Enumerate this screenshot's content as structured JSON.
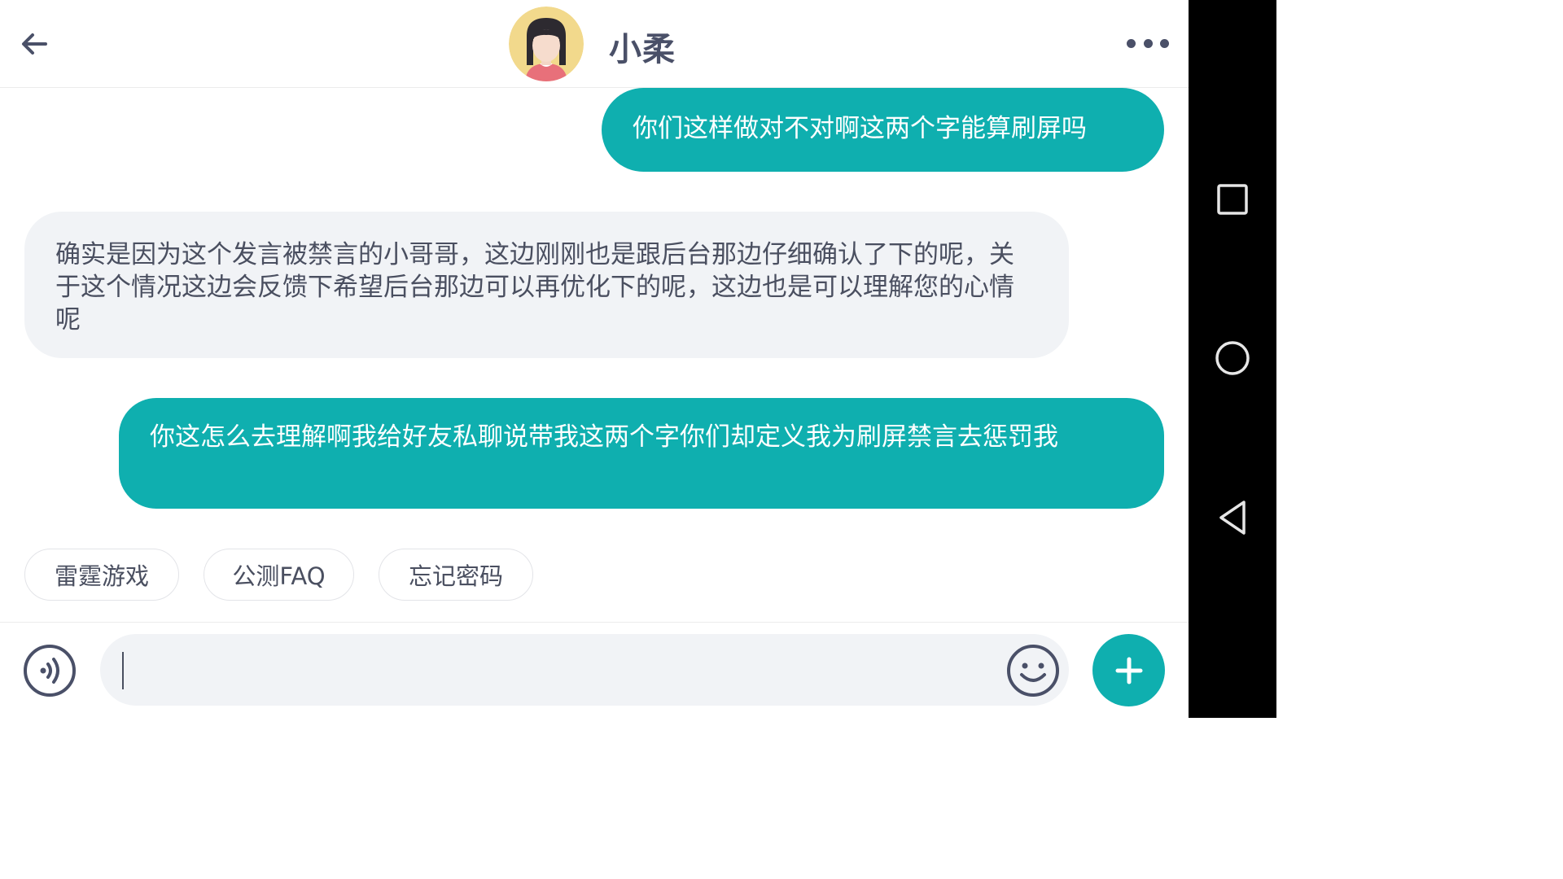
{
  "header": {
    "title": "小柔",
    "back_icon": "back-arrow-icon",
    "more_icon": "more-dots-icon",
    "avatar_icon": "girl-avatar"
  },
  "messages": [
    {
      "side": "out",
      "text": "你们这样做对不对啊这两个字能算刷屏吗"
    },
    {
      "side": "in",
      "text": "确实是因为这个发言被禁言的小哥哥，这边刚刚也是跟后台那边仔细确认了下的呢，关于这个情况这边会反馈下希望后台那边可以再优化下的呢，这边也是可以理解您的心情呢"
    },
    {
      "side": "out",
      "text": "你这怎么去理解啊我给好友私聊说带我这两个字你们却定义我为刷屏禁言去惩罚我"
    }
  ],
  "quick_replies": [
    "雷霆游戏",
    "公测FAQ",
    "忘记密码"
  ],
  "input": {
    "value": "",
    "voice_icon": "voice-icon",
    "emoji_icon": "emoji-icon",
    "plus_icon": "plus-icon"
  },
  "nav": {
    "recents_icon": "square-icon",
    "home_icon": "circle-icon",
    "back_icon": "triangle-back-icon"
  },
  "colors": {
    "accent": "#0fafaf",
    "incoming_bubble": "#f1f3f6",
    "text_dark": "#4a4f60",
    "title": "#4a5068"
  }
}
